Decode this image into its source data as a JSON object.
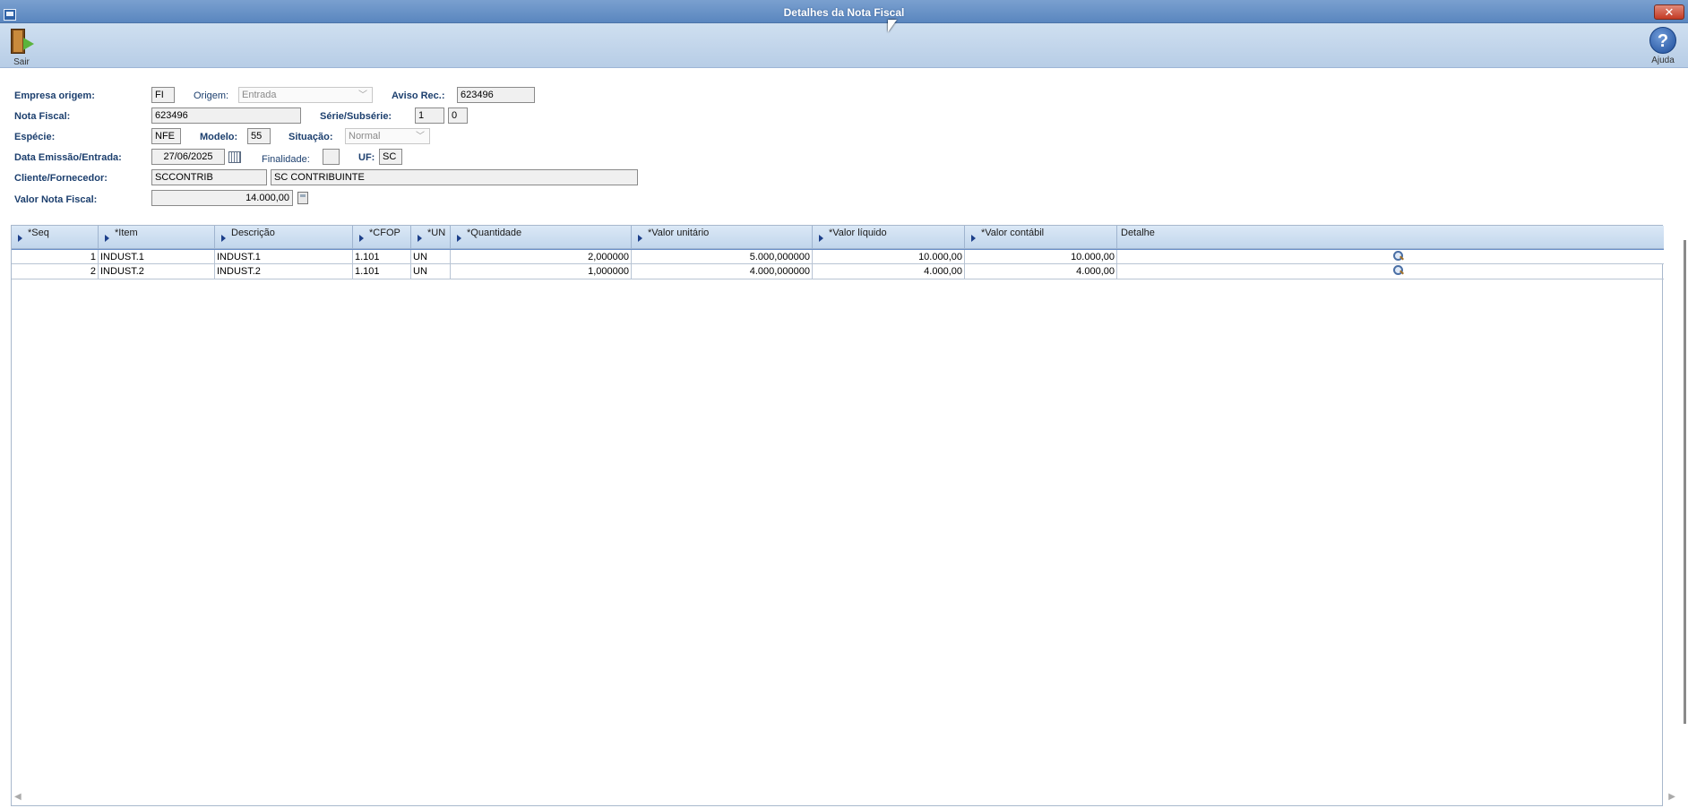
{
  "window": {
    "title": "Detalhes da Nota Fiscal",
    "close_label": "✕"
  },
  "toolbar": {
    "exit_label": "Sair",
    "help_label": "Ajuda",
    "help_glyph": "?"
  },
  "form": {
    "empresa_origem": {
      "label": "Empresa origem:",
      "value": "FI"
    },
    "origem": {
      "label": "Origem:",
      "value": "Entrada"
    },
    "aviso_rec": {
      "label": "Aviso Rec.:",
      "value": "623496"
    },
    "nota_fiscal": {
      "label": "Nota Fiscal:",
      "value": "623496"
    },
    "serie_subserie": {
      "label": "Série/Subsérie:",
      "serie": "1",
      "subserie": "0"
    },
    "especie": {
      "label": "Espécie:",
      "value": "NFE"
    },
    "modelo": {
      "label": "Modelo:",
      "value": "55"
    },
    "situacao": {
      "label": "Situação:",
      "value": "Normal"
    },
    "data_emissao": {
      "label": "Data Emissão/Entrada:",
      "value": "27/06/2025"
    },
    "finalidade": {
      "label": "Finalidade:",
      "value": ""
    },
    "uf": {
      "label": "UF:",
      "value": "SC"
    },
    "cliente_fornecedor": {
      "label": "Cliente/Fornecedor:",
      "code": "SCCONTRIB",
      "name": "SC CONTRIBUINTE"
    },
    "valor_nota": {
      "label": "Valor Nota Fiscal:",
      "value": "14.000,00"
    }
  },
  "grid": {
    "columns": [
      "*Seq",
      "*Item",
      "Descrição",
      "*CFOP",
      "*UN",
      "*Quantidade",
      "*Valor unitário",
      "*Valor líquido",
      "*Valor contábil",
      "Detalhe"
    ],
    "rows": [
      {
        "seq": "1",
        "item": "INDUST.1",
        "descricao": "INDUST.1",
        "cfop": "1.101",
        "un": "UN",
        "quantidade": "2,000000",
        "valor_unitario": "5.000,000000",
        "valor_liquido": "10.000,00",
        "valor_contabil": "10.000,00"
      },
      {
        "seq": "2",
        "item": "INDUST.2",
        "descricao": "INDUST.2",
        "cfop": "1.101",
        "un": "UN",
        "quantidade": "1,000000",
        "valor_unitario": "4.000,000000",
        "valor_liquido": "4.000,00",
        "valor_contabil": "4.000,00"
      }
    ]
  },
  "icons": {
    "app": "window-icon",
    "exit": "door-exit-icon",
    "help": "help-icon",
    "calendar": "calendar-icon",
    "calculator": "calculator-icon",
    "detail": "magnifier-icon",
    "dropdown": "chevron-down-icon",
    "sort": "sort-arrow-icon"
  },
  "colors": {
    "titlebar": "#5a86bf",
    "toolbar": "#c3d6ec",
    "label": "#1c3f6e",
    "header_arrow": "#1c3f8a"
  }
}
